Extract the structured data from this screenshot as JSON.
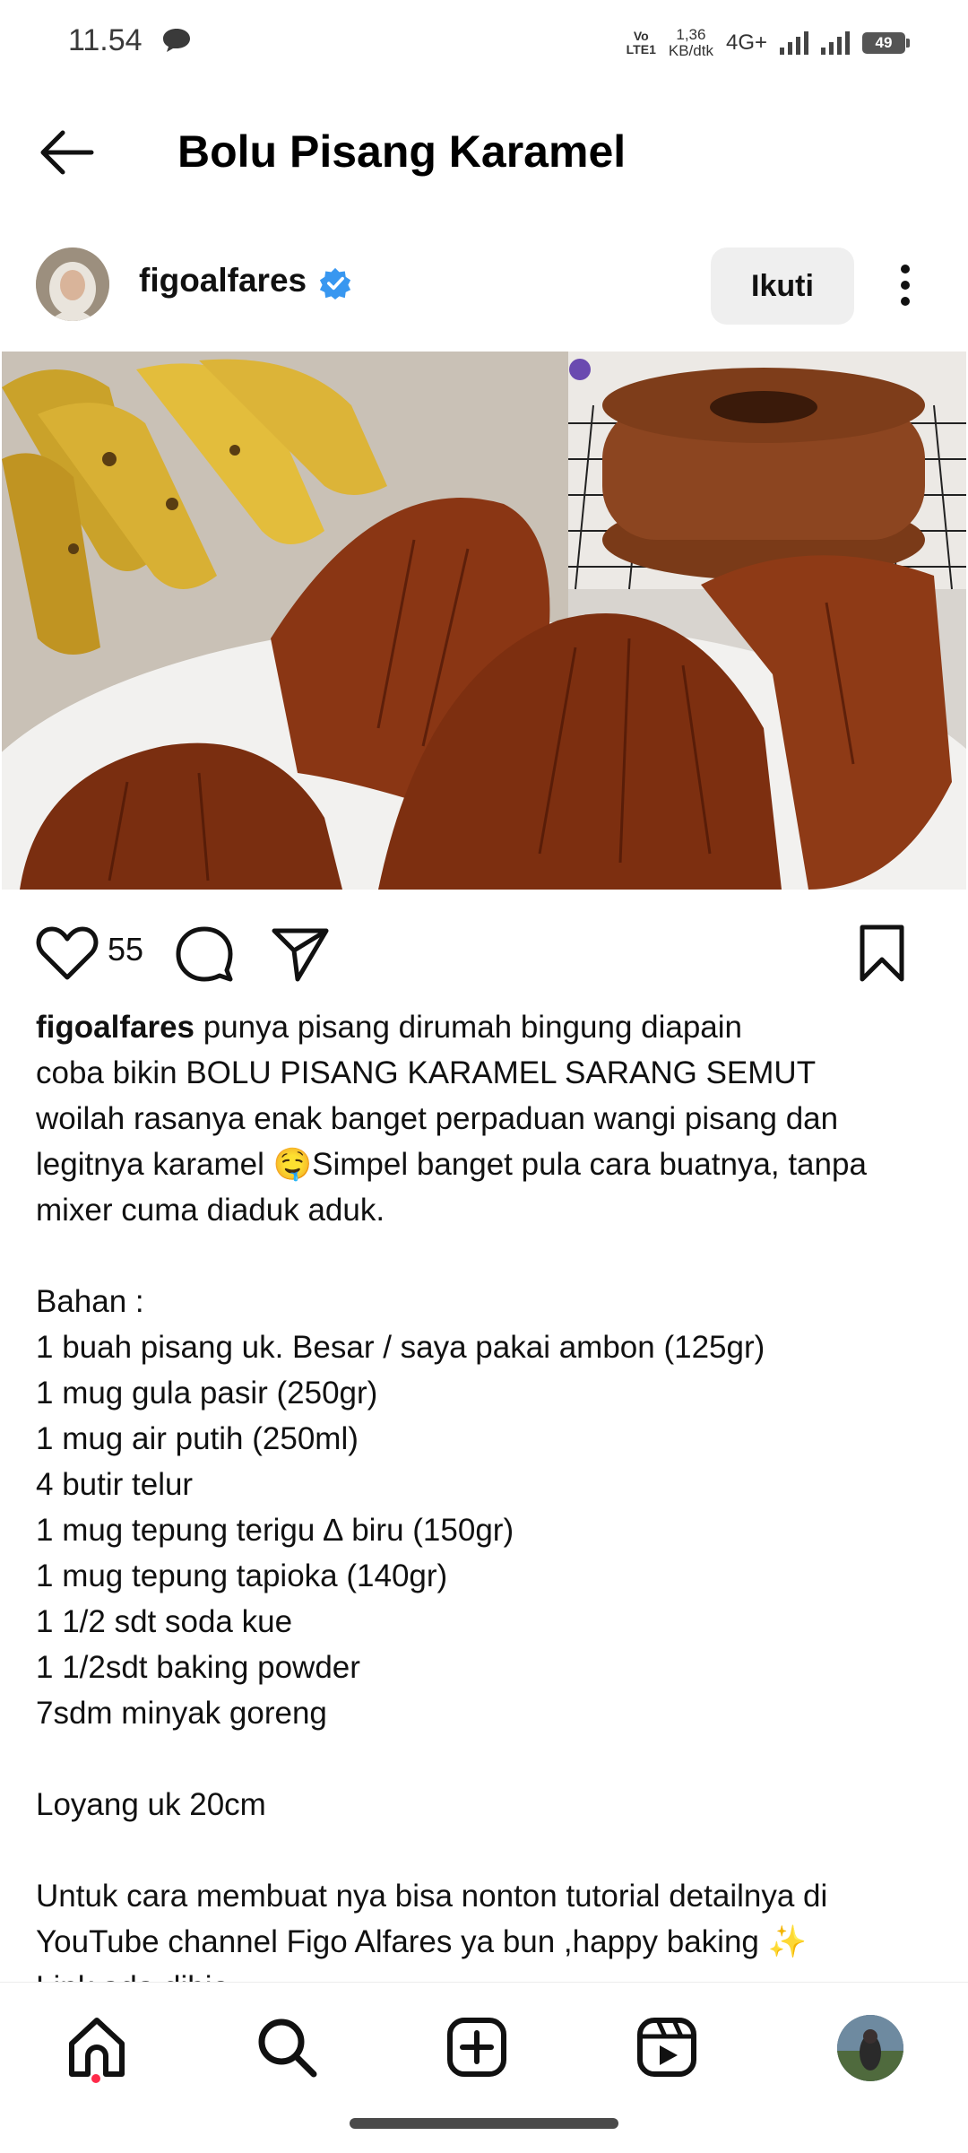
{
  "status_bar": {
    "time": "11.54",
    "volte": "Vo\nLTE1",
    "speed": "1,36\nKB/dtk",
    "network": "4G+",
    "battery": "49"
  },
  "top_bar": {
    "title": "Bolu Pisang Karamel"
  },
  "post": {
    "username": "figoalfares",
    "follow_label": "Ikuti",
    "like_count": "55",
    "caption_text": " punya pisang dirumah bingung diapain\ncoba bikin BOLU PISANG KARAMEL SARANG SEMUT\nwoilah rasanya enak banget perpaduan wangi pisang dan\nlegitnya karamel 🤤Simpel banget pula cara buatnya, tanpa\nmixer cuma diaduk aduk.\n\nBahan :\n1 buah pisang uk. Besar / saya pakai ambon (125gr)\n1 mug gula pasir (250gr)\n1 mug air putih (250ml)\n4 butir telur\n1 mug tepung terigu ∆ biru (150gr)\n1 mug tepung tapioka (140gr)\n1 1/2 sdt soda kue\n1 1/2sdt baking powder\n7sdm minyak goreng\n\nLoyang uk 20cm\n\nUntuk cara membuat nya bisa nonton tutorial detailnya di\nYouTube channel Figo Alfares ya bun ,happy baking ✨\nLink ada dibio"
  },
  "icons": {
    "back": "arrow-left-icon",
    "verified": "verified-badge-icon",
    "more": "more-vertical-icon",
    "like": "heart-icon",
    "comment": "comment-icon",
    "share": "send-icon",
    "save": "bookmark-icon",
    "nav": [
      "home-icon",
      "search-icon",
      "create-icon",
      "reels-icon",
      "profile-avatar"
    ]
  },
  "colors": {
    "verified": "#3897f0",
    "follow_bg": "#efefef",
    "notification_dot": "#ff2a4a"
  }
}
